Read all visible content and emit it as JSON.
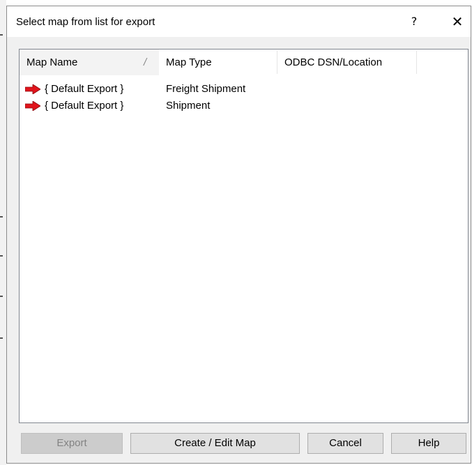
{
  "dialog": {
    "title": "Select map from list for export",
    "help_glyph": "?",
    "close_glyph": "✕"
  },
  "list": {
    "columns": [
      {
        "label": "Map Name",
        "sorted": true
      },
      {
        "label": "Map Type",
        "sorted": false
      },
      {
        "label": "ODBC DSN/Location",
        "sorted": false
      }
    ],
    "sort_glyph": "/",
    "rows": [
      {
        "name": "{ Default Export }",
        "type": "Freight Shipment",
        "location": "",
        "icon": "red-arrow-icon"
      },
      {
        "name": "{ Default Export }",
        "type": "Shipment",
        "location": "",
        "icon": "red-arrow-icon"
      }
    ]
  },
  "buttons": {
    "export": "Export",
    "create_edit": "Create / Edit Map",
    "cancel": "Cancel",
    "help": "Help"
  },
  "colors": {
    "dialog_bg": "#f0f0f0",
    "button_bg": "#e1e1e1",
    "disabled_button_bg": "#cccccc",
    "arrow_red": "#e0141c"
  }
}
